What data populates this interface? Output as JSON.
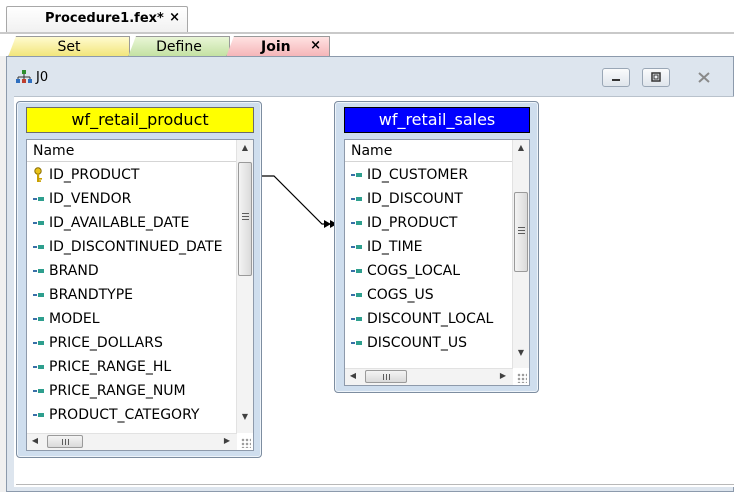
{
  "document_tab": {
    "label": "Procedure1.fex*",
    "close": "×"
  },
  "proc_tabs": {
    "set": "Set",
    "define": "Define",
    "join": "Join",
    "join_close": "×"
  },
  "window": {
    "title": "J0",
    "icon": "join-tree-icon"
  },
  "left_table": {
    "title": "wf_retail_product",
    "title_bg": "#ffff00",
    "column_header": "Name",
    "fields": [
      "ID_PRODUCT",
      "ID_VENDOR",
      "ID_AVAILABLE_DATE",
      "ID_DISCONTINUED_DATE",
      "BRAND",
      "BRANDTYPE",
      "MODEL",
      "PRICE_DOLLARS",
      "PRICE_RANGE_HL",
      "PRICE_RANGE_NUM",
      "PRODUCT_CATEGORY"
    ],
    "key_field_icon": "key-icon",
    "field_icon": "field-icon"
  },
  "right_table": {
    "title": "wf_retail_sales",
    "title_bg": "#0000ff",
    "title_color": "#ffffff",
    "column_header": "Name",
    "fields": [
      "ID_CUSTOMER",
      "ID_DISCOUNT",
      "ID_PRODUCT",
      "ID_TIME",
      "COGS_LOCAL",
      "COGS_US",
      "DISCOUNT_LOCAL",
      "DISCOUNT_US"
    ],
    "field_icon": "field-icon"
  },
  "join_link": {
    "from": "ID_PRODUCT",
    "to": "ID_PRODUCT"
  }
}
